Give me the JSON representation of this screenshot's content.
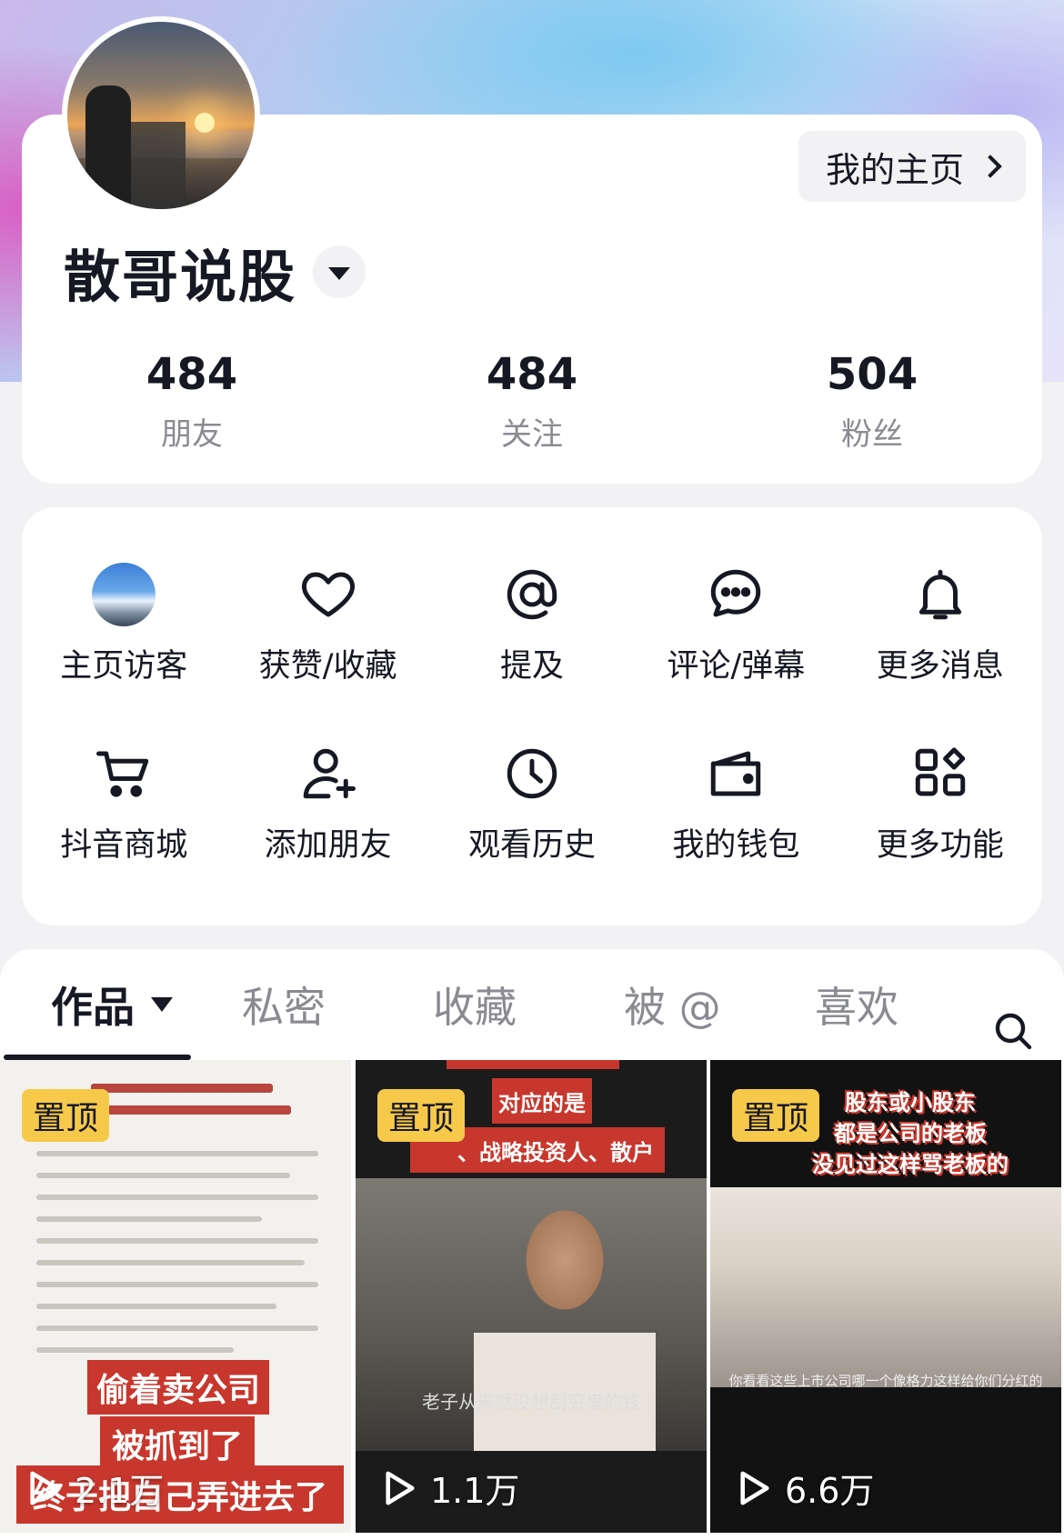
{
  "profile": {
    "home_button_label": "我的主页",
    "username": "散哥说股",
    "stats": [
      {
        "value": "484",
        "label": "朋友"
      },
      {
        "value": "484",
        "label": "关注"
      },
      {
        "value": "504",
        "label": "粉丝"
      }
    ]
  },
  "menu": {
    "items": [
      {
        "label": "主页访客",
        "icon": "visitor-avatar"
      },
      {
        "label": "获赞/收藏",
        "icon": "heart-icon"
      },
      {
        "label": "提及",
        "icon": "at-icon"
      },
      {
        "label": "评论/弹幕",
        "icon": "comment-icon"
      },
      {
        "label": "更多消息",
        "icon": "bell-icon"
      },
      {
        "label": "抖音商城",
        "icon": "cart-icon"
      },
      {
        "label": "添加朋友",
        "icon": "add-user-icon"
      },
      {
        "label": "观看历史",
        "icon": "clock-icon"
      },
      {
        "label": "我的钱包",
        "icon": "wallet-icon"
      },
      {
        "label": "更多功能",
        "icon": "grid-icon"
      }
    ]
  },
  "tabs": {
    "items": [
      "作品",
      "私密",
      "收藏",
      "被 @",
      "喜欢"
    ],
    "active": "作品"
  },
  "videos": [
    {
      "pin_label": "置顶",
      "views": "2.1万",
      "captions": [
        "偷着卖公司",
        "被抓到了",
        "终于把自己弄进去了"
      ]
    },
    {
      "pin_label": "置顶",
      "views": "1.1万",
      "captions": [
        "对应的是",
        "、战略投资人、散户",
        "老子从来就没想刮穷鬼的钱"
      ]
    },
    {
      "pin_label": "置顶",
      "views": "6.6万",
      "captions": [
        "股东或小股东",
        "都是公司的老板",
        "没见过这样骂老板的",
        "你看看这些上市公司哪一个像格力这样给你们分红的"
      ]
    }
  ],
  "colors": {
    "pin_bg": "#f6c94a",
    "caption_red": "#c8372d",
    "muted_text": "#8a8b91"
  }
}
